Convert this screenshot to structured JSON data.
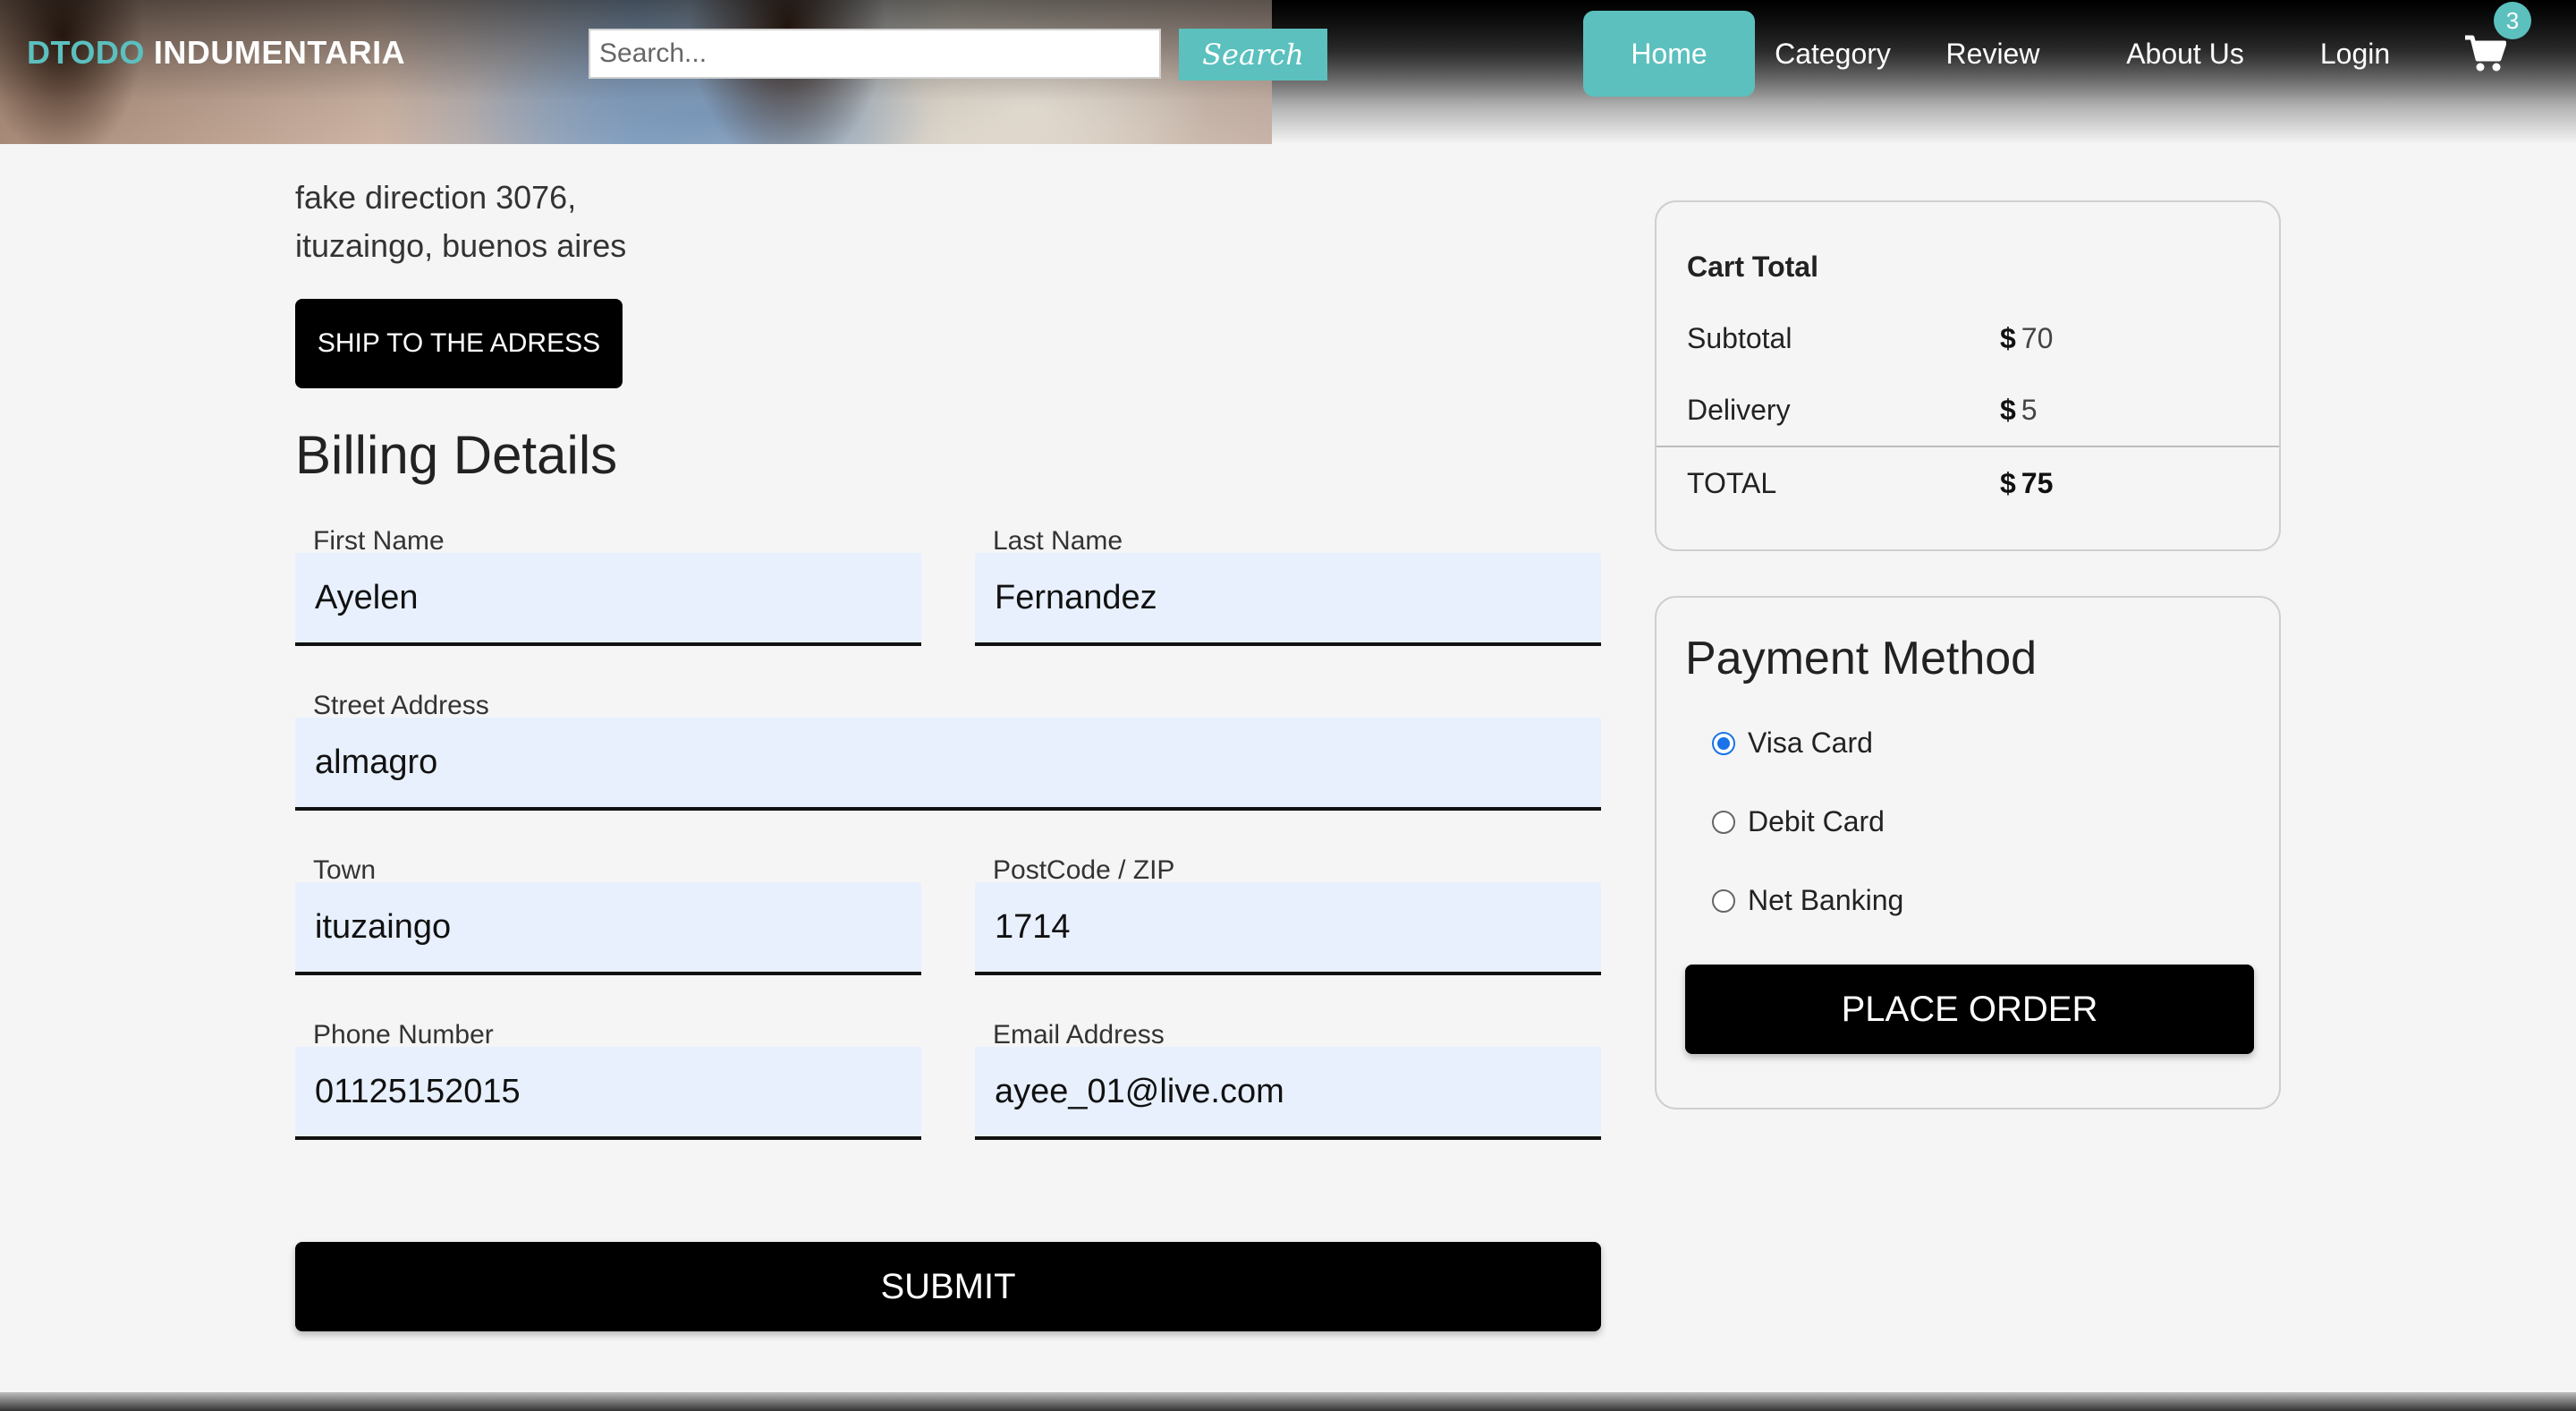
{
  "header": {
    "logo_accent": "DTODO",
    "logo_rest": "INDUMENTARIA",
    "search_placeholder": "Search...",
    "search_button": "Search",
    "nav": [
      {
        "label": "Home",
        "active": true
      },
      {
        "label": "Category",
        "active": false
      },
      {
        "label": "Review",
        "active": false
      },
      {
        "label": "About Us",
        "active": false
      },
      {
        "label": "Login",
        "active": false
      }
    ],
    "cart_icon": "shopping-cart-icon",
    "cart_count": "3",
    "accent_color": "#5bc0be"
  },
  "address": {
    "line1": "fake direction 3076,",
    "line2": "ituzaingo, buenos aires",
    "ship_button": "SHIP TO THE ADRESS"
  },
  "billing": {
    "title": "Billing Details",
    "first_name_label": "First Name",
    "first_name": "Ayelen",
    "last_name_label": "Last Name",
    "last_name": "Fernandez",
    "street_label": "Street Address",
    "street": "almagro",
    "town_label": "Town",
    "town": "ituzaingo",
    "postcode_label": "PostCode / ZIP",
    "postcode": "1714",
    "phone_label": "Phone Number",
    "phone": "01125152015",
    "email_label": "Email Address",
    "email": "ayee_01@live.com",
    "submit": "SUBMIT"
  },
  "cart_total": {
    "title": "Cart Total",
    "currency": "$",
    "subtotal_label": "Subtotal",
    "subtotal": "70",
    "delivery_label": "Delivery",
    "delivery": "5",
    "total_label": "TOTAL",
    "total": "75"
  },
  "payment": {
    "title": "Payment Method",
    "options": [
      {
        "label": "Visa Card",
        "checked": true
      },
      {
        "label": "Debit Card",
        "checked": false
      },
      {
        "label": "Net Banking",
        "checked": false
      }
    ],
    "place_order": "PLACE ORDER"
  }
}
